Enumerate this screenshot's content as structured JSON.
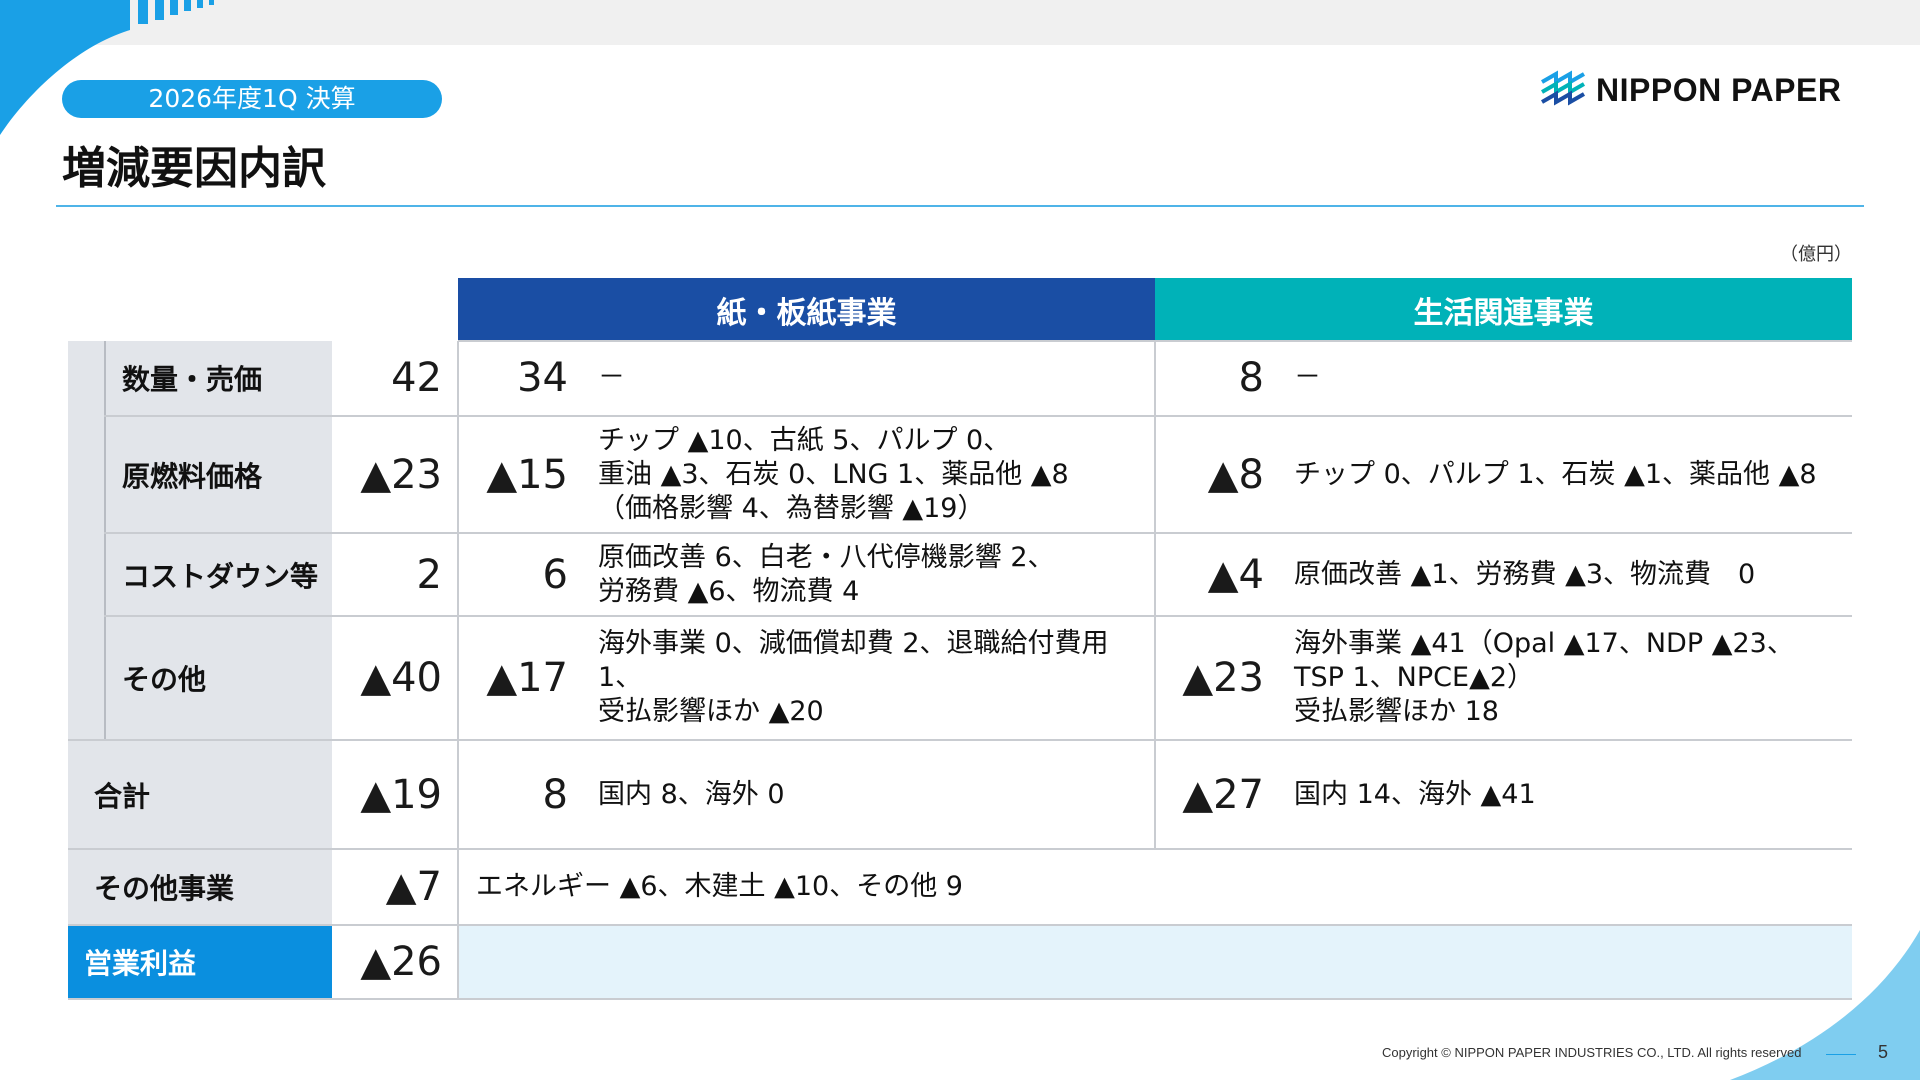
{
  "header": {
    "badge": "2026年度1Q 決算",
    "title": "増減要因内訳",
    "logo_text": "NIPPON PAPER",
    "unit": "（億円）"
  },
  "columns": {
    "paper": "紙・板紙事業",
    "life": "生活関連事業"
  },
  "rows": [
    {
      "label": "数量・売価",
      "total": "42",
      "paper_value": "34",
      "paper_detail": "－",
      "life_value": "8",
      "life_detail": "－"
    },
    {
      "label": "原燃料価格",
      "total": "▲23",
      "paper_value": "▲15",
      "paper_detail": "チップ ▲10、古紙 5、パルプ 0、\n重油 ▲3、石炭 0、LNG 1、薬品他 ▲8\n（価格影響 4、為替影響 ▲19）",
      "life_value": "▲8",
      "life_detail": "チップ 0、パルプ 1、石炭 ▲1、薬品他 ▲8"
    },
    {
      "label": "コストダウン等",
      "total": "2",
      "paper_value": "6",
      "paper_detail": "原価改善 6、白老・八代停機影響 2、\n労務費 ▲6、物流費 4",
      "life_value": "▲4",
      "life_detail": "原価改善 ▲1、労務費 ▲3、物流費　0"
    },
    {
      "label": "その他",
      "total": "▲40",
      "paper_value": "▲17",
      "paper_detail": "海外事業 0、減価償却費 2、退職給付費用 1、\n受払影響ほか ▲20",
      "life_value": "▲23",
      "life_detail": "海外事業 ▲41（Opal ▲17、NDP ▲23、\nTSP 1、NPCE▲2）\n受払影響ほか 18"
    },
    {
      "label": "合計",
      "total": "▲19",
      "paper_value": "8",
      "paper_detail": "国内 8、海外 0",
      "life_value": "▲27",
      "life_detail": "国内 14、海外 ▲41"
    }
  ],
  "other_business": {
    "label": "その他事業",
    "total": "▲7",
    "detail": "エネルギー ▲6、木建土 ▲10、その他 9"
  },
  "operating_profit": {
    "label": "営業利益",
    "total": "▲26"
  },
  "footer": {
    "copyright": "Copyright © NIPPON PAPER INDUSTRIES CO., LTD. All rights reserved",
    "page": "5"
  },
  "colors": {
    "accent": "#1aa0e6",
    "paper_header": "#1a4ea4",
    "life_header": "#00b2b8",
    "operating_profit": "#0a8fdf"
  }
}
